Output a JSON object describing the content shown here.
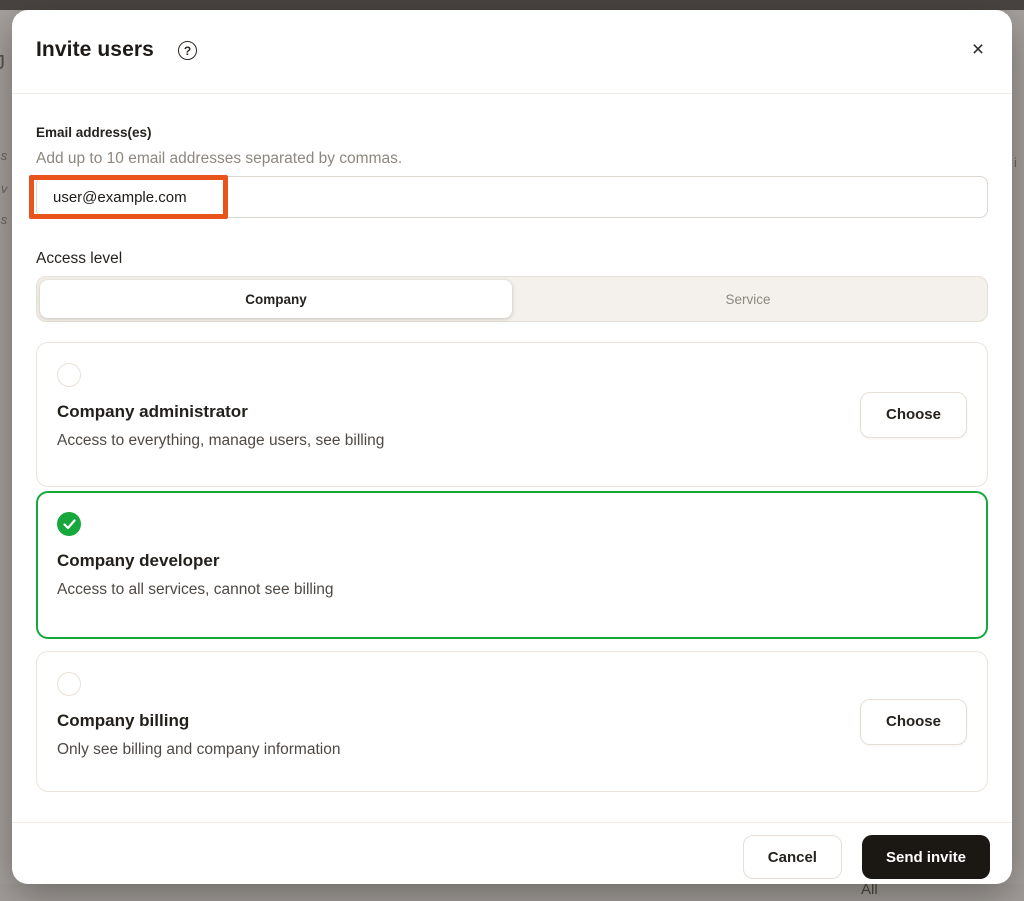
{
  "background": {
    "artifacts": {
      "left_top": "J",
      "left_a": "s",
      "left_b": "v",
      "left_c": "s",
      "right_a": "i",
      "bottom_a": "All"
    }
  },
  "modal": {
    "title": "Invite users",
    "help_icon": "?",
    "close_icon": "×",
    "email_section": {
      "label": "Email address(es)",
      "helper": "Add up to 10 email addresses separated by commas.",
      "input_value": "user@example.com"
    },
    "access_level": {
      "label": "Access level",
      "tabs": [
        {
          "label": "Company",
          "selected": true
        },
        {
          "label": "Service",
          "selected": false
        }
      ]
    },
    "options": [
      {
        "title": "Company administrator",
        "description": "Access to everything, manage users, see billing",
        "selected": false,
        "action_label": "Choose"
      },
      {
        "title": "Company developer",
        "description": "Access to all services, cannot see billing",
        "selected": true
      },
      {
        "title": "Company billing",
        "description": "Only see billing and company information",
        "selected": false,
        "action_label": "Choose"
      }
    ],
    "footer": {
      "cancel_label": "Cancel",
      "submit_label": "Send invite"
    }
  },
  "colors": {
    "accent_green": "#18a73c",
    "annotation_orange": "#e8541c",
    "submit_button": "#1b1713",
    "overlay_background": "#a7a29f",
    "segment_background": "#f4f0eb"
  }
}
